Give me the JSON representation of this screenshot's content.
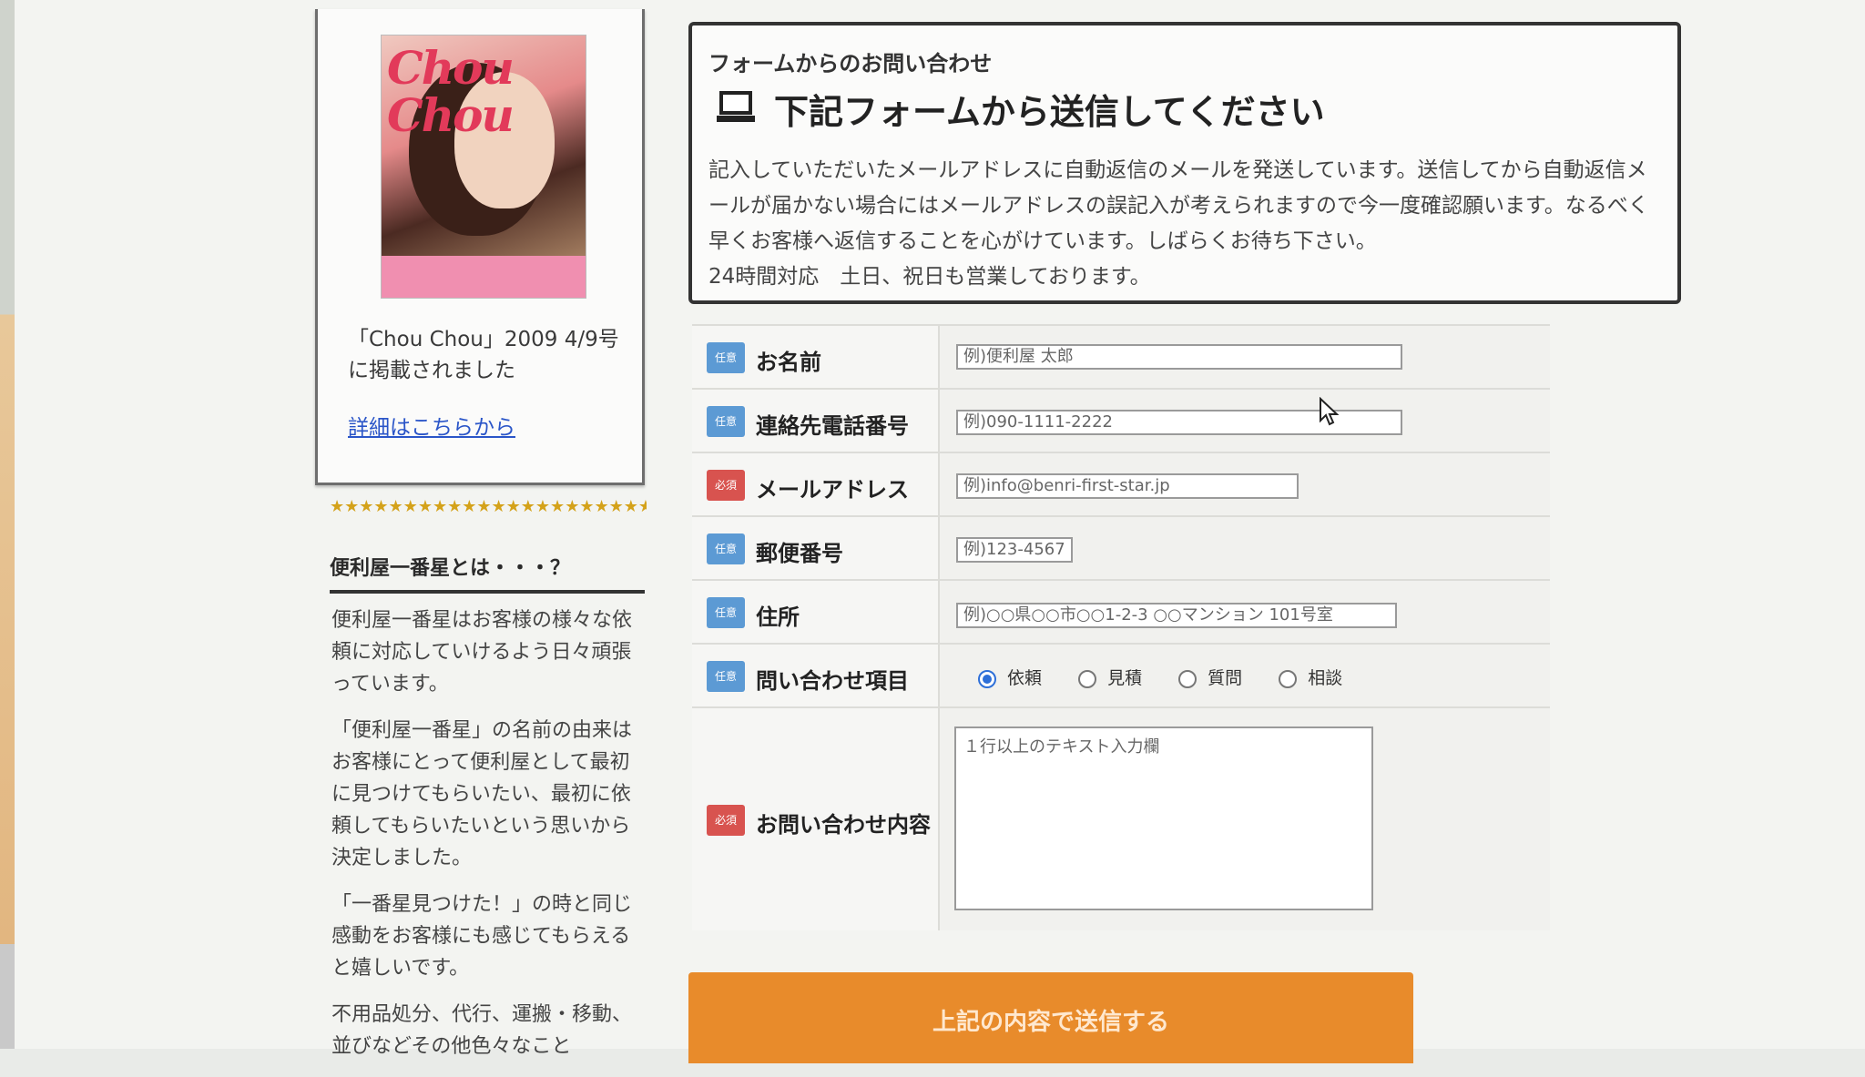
{
  "sidebar": {
    "magazine_logo": "Chou Chou",
    "magazine_caption": "「Chou Chou」2009 4/9号に掲載されました",
    "detail_link": "詳細はこちらから",
    "stars": "★★★★★★★★★★★★★★★★★★★★★★★",
    "about_title": "便利屋一番星とは・・・？",
    "about_paragraphs": [
      "便利屋一番星はお客様の様々な依頼に対応していけるよう日々頑張っています。",
      "「便利屋一番星」の名前の由来はお客様にとって便利屋として最初に見つけてもらいたい、最初に依頼してもらいたいという思いから決定しました。",
      "「一番星見つけた！」の時と同じ感動をお客様にも感じてもらえると嬉しいです。",
      "不用品処分、代行、運搬・移動、並びなどその他色々なこと"
    ]
  },
  "notice": {
    "subtitle": "フォームからのお問い合わせ",
    "title": "下記フォームから送信してください",
    "body": "記入していただいたメールアドレスに自動返信のメールを発送しています。送信してから自動返信メールが届かない場合にはメールアドレスの誤記入が考えられますので今一度確認願います。なるべく早くお客様へ返信することを心がけています。しばらくお待ち下さい。",
    "hours": "24時間対応　土日、祝日も営業しております。"
  },
  "form": {
    "badge_optional": "任意",
    "badge_required": "必須",
    "fields": [
      {
        "label": "お名前",
        "placeholder": "例)便利屋 太郎",
        "required": false
      },
      {
        "label": "連絡先電話番号",
        "placeholder": "例)090-1111-2222",
        "required": false
      },
      {
        "label": "メールアドレス",
        "placeholder": "例)info@benri-first-star.jp",
        "required": true
      },
      {
        "label": "郵便番号",
        "placeholder": "例)123-4567",
        "required": false
      },
      {
        "label": "住所",
        "placeholder": "例)○○県○○市○○1-2-3 ○○マンション 101号室",
        "required": false
      }
    ],
    "inquiry_type": {
      "label": "問い合わせ項目",
      "required": false,
      "options": [
        "依頼",
        "見積",
        "質問",
        "相談"
      ],
      "selected": "依頼"
    },
    "message": {
      "label": "お問い合わせ内容",
      "required": true,
      "placeholder": "１行以上のテキスト入力欄"
    },
    "submit_label": "上記の内容で送信する"
  },
  "colors": {
    "badge_optional": "#5c9ad4",
    "badge_required": "#d8534f",
    "submit": "#e88b2b",
    "link": "#2a55c8"
  }
}
